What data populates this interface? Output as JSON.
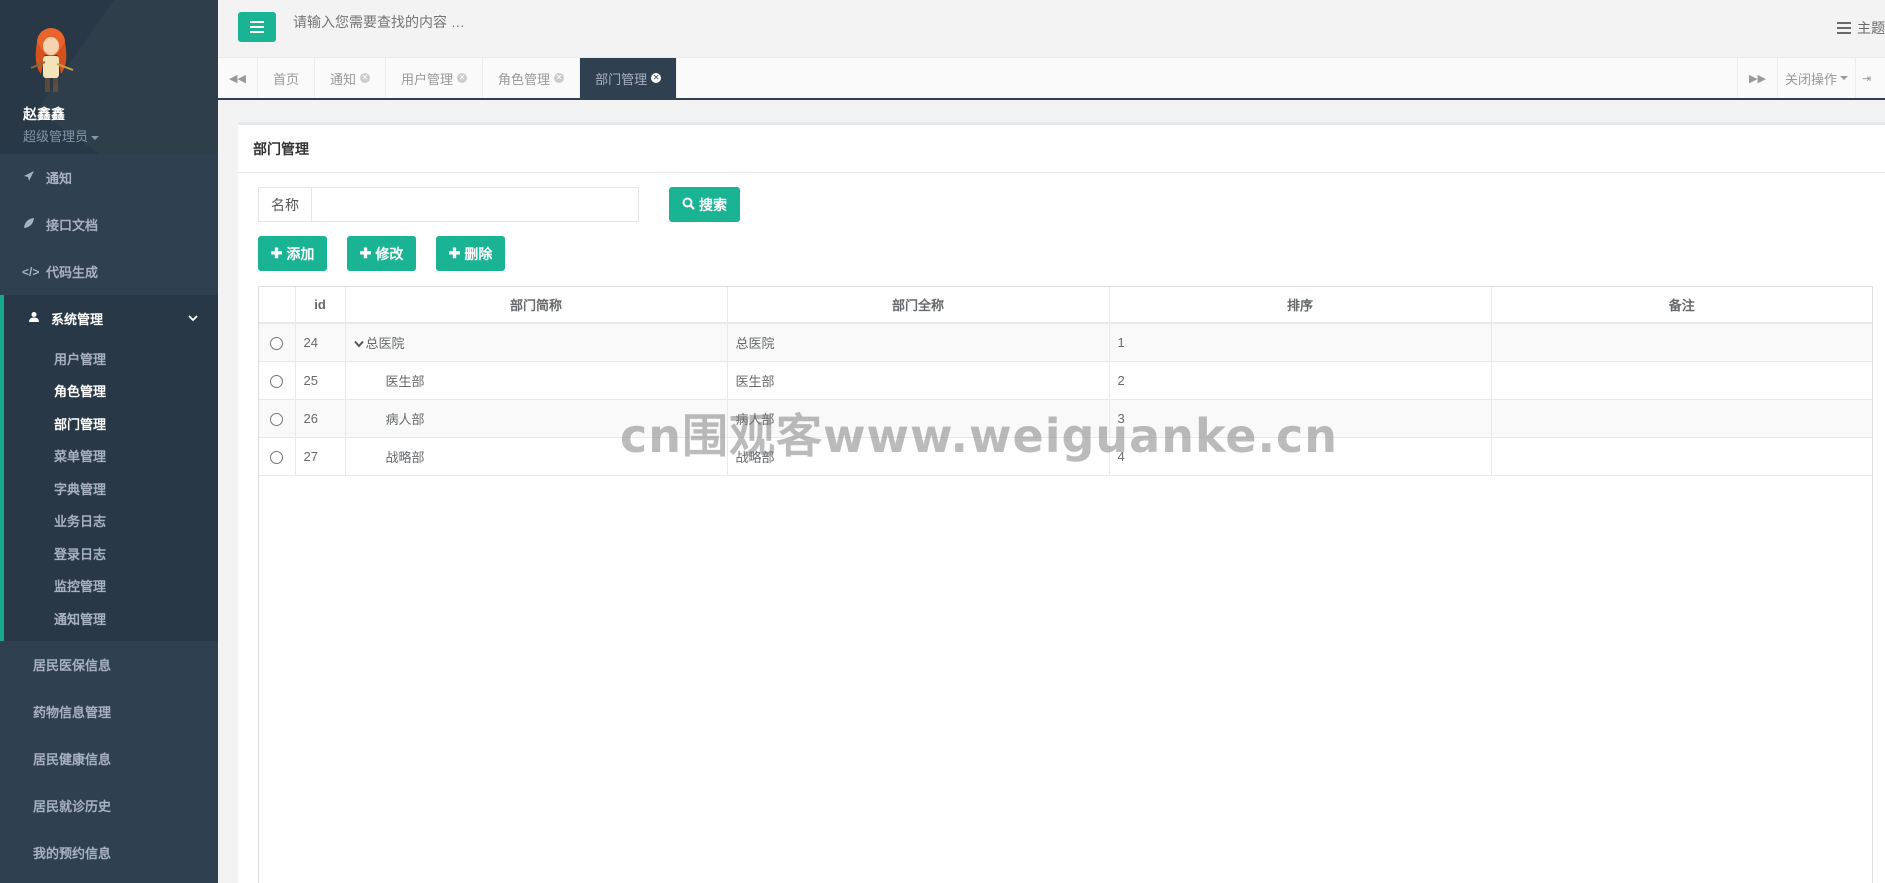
{
  "sidebar": {
    "user_name": "赵鑫鑫",
    "user_role": "超级管理员",
    "items": [
      {
        "label": "通知",
        "icon": "paper-plane-icon"
      },
      {
        "label": "接口文档",
        "icon": "leaf-icon"
      },
      {
        "label": "代码生成",
        "icon": "code-icon"
      }
    ],
    "group": {
      "label": "系统管理",
      "icon": "user-icon",
      "sub_items": [
        "用户管理",
        "角色管理",
        "部门管理",
        "菜单管理",
        "字典管理",
        "业务日志",
        "登录日志",
        "监控管理",
        "通知管理"
      ]
    },
    "bottom_items": [
      "居民医保信息",
      "药物信息管理",
      "居民健康信息",
      "居民就诊历史",
      "我的预约信息"
    ]
  },
  "topbar": {
    "search_placeholder": "请输入您需要查找的内容 …",
    "theme_label": "主题"
  },
  "tabs": {
    "items": [
      {
        "label": "首页",
        "closable": false
      },
      {
        "label": "通知",
        "closable": true
      },
      {
        "label": "用户管理",
        "closable": true
      },
      {
        "label": "角色管理",
        "closable": true
      },
      {
        "label": "部门管理",
        "closable": true,
        "active": true
      }
    ],
    "close_ops_label": "关闭操作",
    "exit_label": "退出"
  },
  "panel": {
    "title": "部门管理",
    "search_label": "名称",
    "search_value": "",
    "search_button": "搜索",
    "add_button": "添加",
    "edit_button": "修改",
    "delete_button": "删除"
  },
  "table": {
    "columns": [
      "",
      "id",
      "部门简称",
      "部门全称",
      "排序",
      "备注"
    ],
    "rows": [
      {
        "id": "24",
        "short_name": "总医院",
        "full_name": "总医院",
        "sort": "1",
        "remark": ""
      },
      {
        "id": "25",
        "short_name": "医生部",
        "full_name": "医生部",
        "sort": "2",
        "remark": ""
      },
      {
        "id": "26",
        "short_name": "病人部",
        "full_name": "病人部",
        "sort": "3",
        "remark": ""
      },
      {
        "id": "27",
        "short_name": "战略部",
        "full_name": "战略部",
        "sort": "4",
        "remark": ""
      }
    ]
  },
  "watermark": "cn围观客www.weiguanke.cn",
  "colors": {
    "sidebar_bg": "#2f4050",
    "accent": "#1ab394"
  }
}
